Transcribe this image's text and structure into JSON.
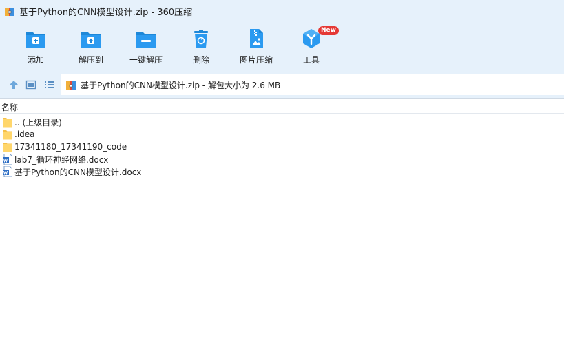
{
  "window": {
    "title": "基于Python的CNN模型设计.zip - 360压缩",
    "icon": "archive-icon"
  },
  "toolbar": {
    "items": [
      {
        "label": "添加",
        "icon": "add-icon"
      },
      {
        "label": "解压到",
        "icon": "extract-to-icon"
      },
      {
        "label": "一键解压",
        "icon": "one-click-extract-icon"
      },
      {
        "label": "删除",
        "icon": "delete-icon"
      },
      {
        "label": "图片压缩",
        "icon": "image-compress-icon"
      },
      {
        "label": "工具",
        "icon": "tools-icon",
        "badge": "New"
      }
    ]
  },
  "nav": {
    "up_icon": "up-arrow-icon",
    "view_icon": "view-mode-icon",
    "list_icon": "list-view-icon",
    "path": "基于Python的CNN模型设计.zip - 解包大小为 2.6 MB"
  },
  "columns": {
    "name": "名称"
  },
  "files": [
    {
      "name": ".. (上级目录)",
      "type": "folder"
    },
    {
      "name": ".idea",
      "type": "folder"
    },
    {
      "name": "17341180_17341190_code",
      "type": "folder"
    },
    {
      "name": "lab7_循环神经网络.docx",
      "type": "docx"
    },
    {
      "name": "基于Python的CNN模型设计.docx",
      "type": "docx"
    }
  ],
  "colors": {
    "accent": "#1e88d8",
    "chrome": "#e6f1fb",
    "folder": "#f5c04a",
    "badge": "#e53935"
  }
}
